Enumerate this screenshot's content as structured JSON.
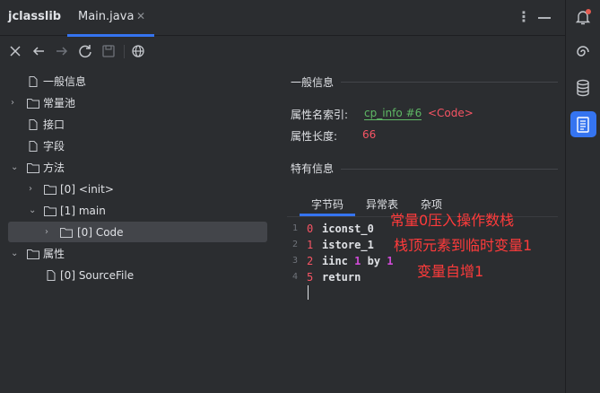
{
  "app": {
    "title": "jclasslib"
  },
  "tabs": [
    {
      "label": "Main.java",
      "close": "✕"
    }
  ],
  "tree": {
    "general": "一般信息",
    "constant_pool": "常量池",
    "interfaces": "接口",
    "fields": "字段",
    "methods": "方法",
    "method_init": "[0] <init>",
    "method_main": "[1] main",
    "code_attr": "[0] Code",
    "attributes": "属性",
    "source_file": "[0] SourceFile"
  },
  "detail": {
    "general_title": "一般信息",
    "attr_name_index_label": "属性名索引:",
    "attr_name_index_link": "cp_info #6",
    "attr_name_index_value": "<Code>",
    "attr_length_label": "属性长度:",
    "attr_length_value": "66",
    "specific_title": "特有信息",
    "subtabs": [
      "字节码",
      "异常表",
      "杂项"
    ]
  },
  "bytecode": [
    {
      "line": "1",
      "offset": "0",
      "instr": "iconst_0"
    },
    {
      "line": "2",
      "offset": "1",
      "instr": "istore_1"
    },
    {
      "line": "3",
      "offset": "2",
      "instr": "iinc",
      "arg1": "1",
      "by": "by",
      "arg2": "1"
    },
    {
      "line": "4",
      "offset": "5",
      "instr": "return"
    }
  ],
  "annotations": [
    "常量0压入操作数栈",
    "栈顶元素到临时变量1",
    "变量自增1"
  ],
  "colors": {
    "accent": "#3574f0",
    "link": "#5fb865",
    "number": "#f75464",
    "annotation": "#ff3b3b",
    "notification_dot": "#e55b50"
  }
}
